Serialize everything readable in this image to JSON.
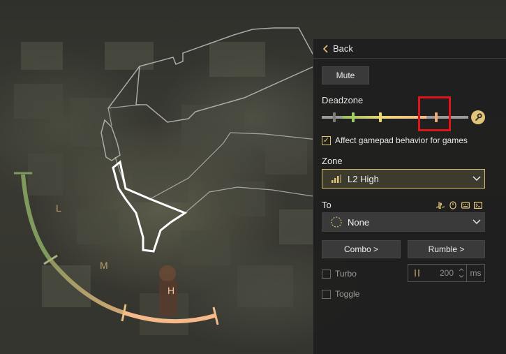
{
  "overlay": {
    "zone_labels": {
      "low": "L",
      "mid": "M",
      "high": "H"
    }
  },
  "panel": {
    "back_label": "Back",
    "mute_label": "Mute",
    "deadzone_label": "Deadzone",
    "affect_label": "Affect gamepad behavior for games",
    "affect_checked": true,
    "zone_label": "Zone",
    "zone_value": "L2 High",
    "to_label": "To",
    "to_value": "None",
    "to_device_icons": [
      "playstation-icon",
      "mouse-icon",
      "keyboard-icon",
      "terminal-icon"
    ],
    "combo_label": "Combo >",
    "rumble_label": "Rumble >",
    "turbo_label": "Turbo",
    "turbo_checked": false,
    "turbo_value": "200",
    "turbo_unit": "ms",
    "toggle_label": "Toggle",
    "toggle_checked": false
  },
  "colors": {
    "accent": "#e2c478",
    "highlight": "#e0141b",
    "zone_low": "#7f9a5c",
    "zone_high": "#f6b98a"
  }
}
